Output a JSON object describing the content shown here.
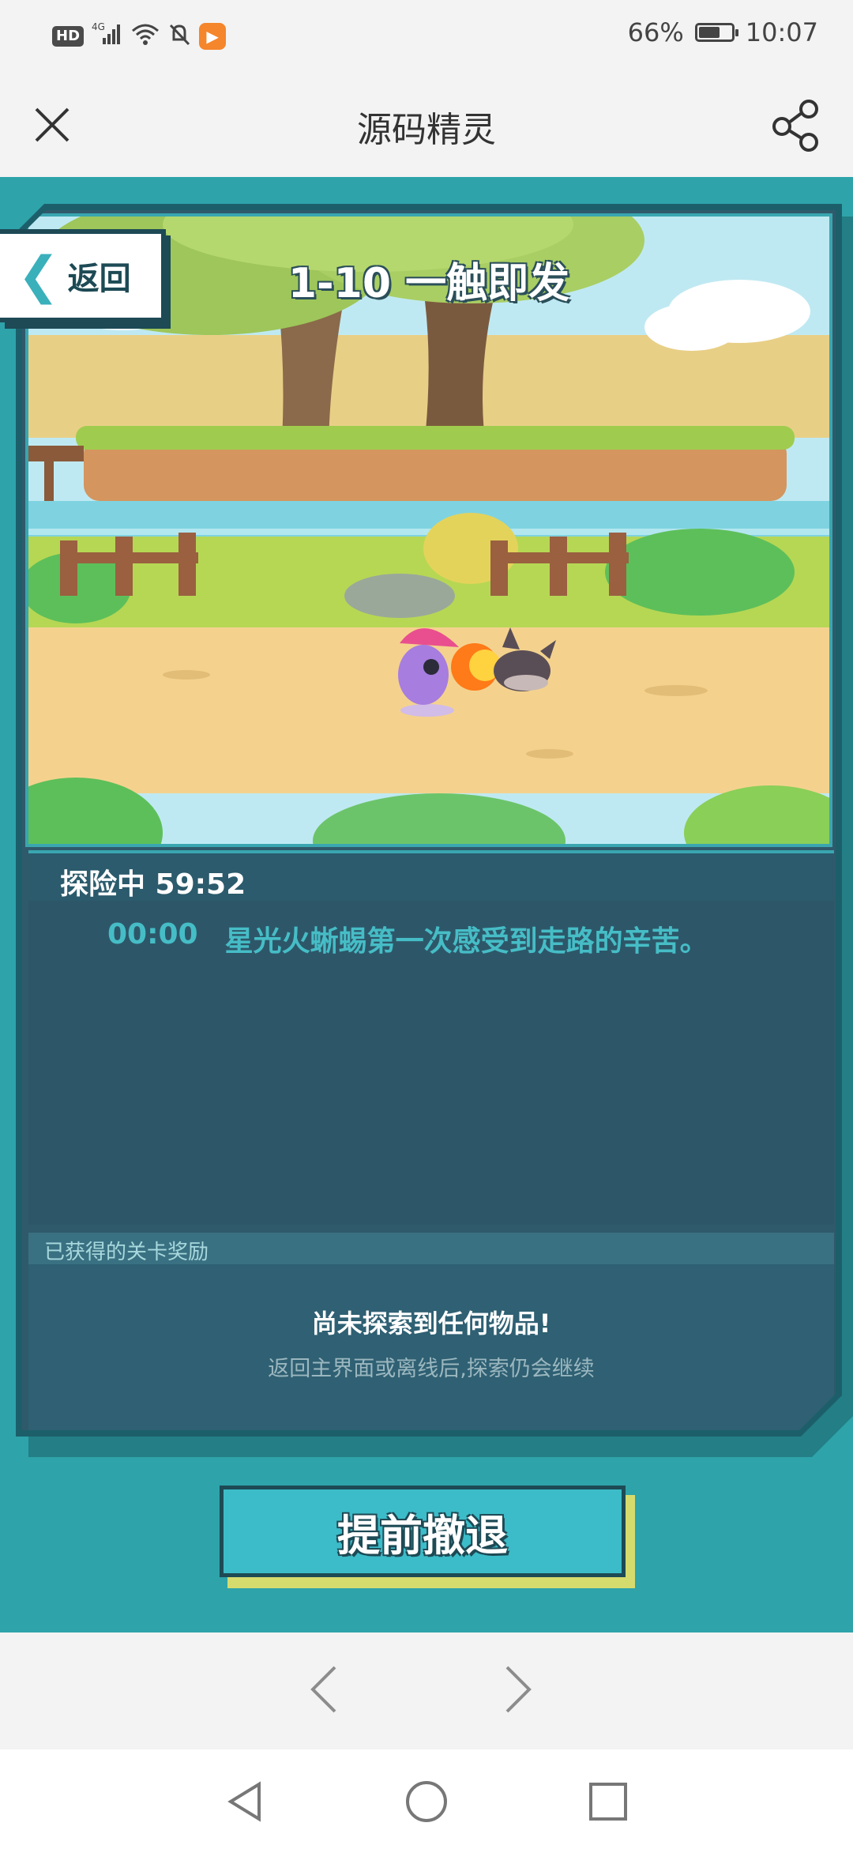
{
  "status_bar": {
    "hd": "HD",
    "signal": "4G",
    "battery_text": "66%",
    "battery_level": 0.66,
    "time": "10:07"
  },
  "titlebar": {
    "title": "源码精灵"
  },
  "game": {
    "back_label": "返回",
    "level_title": "1-10 一触即发",
    "status_label": "探险中 59:52",
    "log": [
      {
        "time": "00:00",
        "text": "星光火蜥蜴第一次感受到走路的辛苦。"
      }
    ],
    "reward_header": "已获得的关卡奖励",
    "reward_empty_title": "尚未探索到任何物品!",
    "reward_empty_sub": "返回主界面或离线后,探索仍会继续",
    "retreat_label": "提前撤退"
  },
  "colors": {
    "game_bg": "#2ea3aa",
    "panel": "#2f5a6b",
    "accent": "#3cbcc8",
    "log_text": "#46bdc6"
  }
}
